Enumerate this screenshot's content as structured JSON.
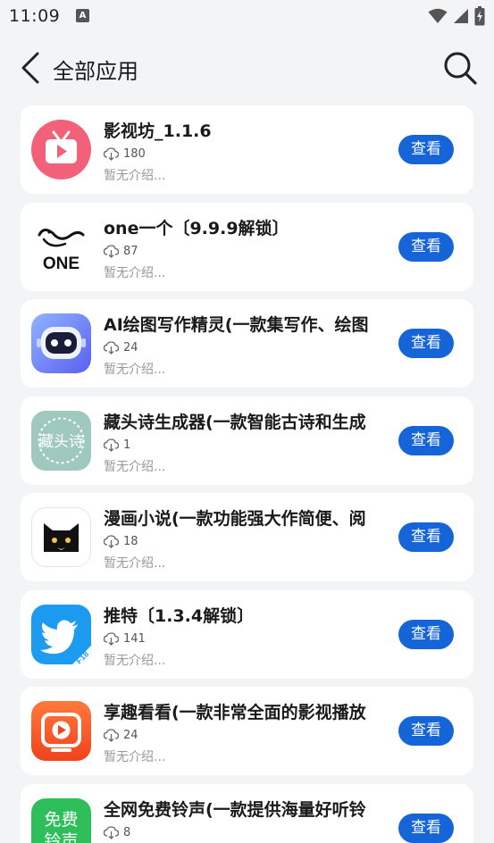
{
  "status_bar": {
    "time": "11:09",
    "notification_badge": "A"
  },
  "header": {
    "title": "全部应用"
  },
  "apps": [
    {
      "name": "影视坊_1.1.6",
      "downloads": "180",
      "desc": "暂无介绍...",
      "button": "查看",
      "icon": "tv-play-icon"
    },
    {
      "name": "one一个〔9.9.9解锁〕",
      "downloads": "87",
      "desc": "暂无介绍...",
      "button": "查看",
      "icon": "one-logo-icon",
      "icon_text": "ONE"
    },
    {
      "name": "AI绘图写作精灵(一款集写作、绘图",
      "downloads": "24",
      "desc": "暂无介绍...",
      "button": "查看",
      "icon": "robot-icon"
    },
    {
      "name": "藏头诗生成器(一款智能古诗和生成",
      "downloads": "1",
      "desc": "暂无介绍...",
      "button": "查看",
      "icon": "poem-seal-icon",
      "icon_text": "藏头诗"
    },
    {
      "name": "漫画小说(一款功能强大作简便、阅",
      "downloads": "18",
      "desc": "暂无介绍...",
      "button": "查看",
      "icon": "cat-icon"
    },
    {
      "name": "推特〔1.3.4解锁〕",
      "downloads": "141",
      "desc": "暂无介绍...",
      "button": "查看",
      "icon": "bird-icon",
      "icon_text": "F18"
    },
    {
      "name": "享趣看看(一款非常全面的影视播放",
      "downloads": "24",
      "desc": "暂无介绍...",
      "button": "查看",
      "icon": "video-play-icon"
    },
    {
      "name": "全网免费铃声(一款提供海量好听铃",
      "downloads": "8",
      "desc": "",
      "button": "查看",
      "icon": "ringtone-icon",
      "icon_text": "免费铃声"
    }
  ]
}
